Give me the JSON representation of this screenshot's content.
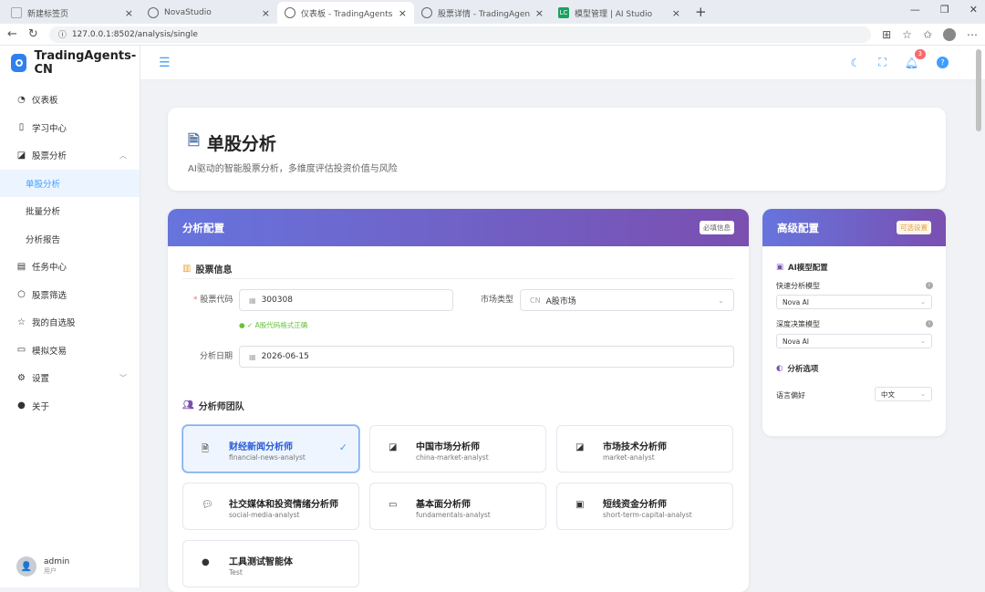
{
  "browser": {
    "tabs": [
      {
        "title": "新建标签页",
        "icon": "page-icon"
      },
      {
        "title": "NovaStudio",
        "icon": "globe-icon"
      },
      {
        "title": "仪表板 - TradingAgents-CN",
        "icon": "globe-icon",
        "active": true
      },
      {
        "title": "股票详情 - TradingAgents-CN",
        "icon": "globe-icon"
      },
      {
        "title": "模型管理 | AI Studio",
        "icon": "ai-studio-icon",
        "icon_text": "LC"
      }
    ],
    "new_tab": "+",
    "url": "127.0.0.1:8502/analysis/single"
  },
  "app": {
    "name": "TradingAgents-CN",
    "notification_count": "3"
  },
  "sidebar": {
    "items": [
      {
        "label": "仪表板",
        "icon": "dashboard-icon"
      },
      {
        "label": "学习中心",
        "icon": "book-icon"
      },
      {
        "label": "股票分析",
        "icon": "chart-icon",
        "expanded": true
      },
      {
        "label": "单股分析",
        "sub": true,
        "active": true
      },
      {
        "label": "批量分析",
        "sub": true
      },
      {
        "label": "分析报告",
        "sub": true
      },
      {
        "label": "任务中心",
        "icon": "clipboard-icon"
      },
      {
        "label": "股票筛选",
        "icon": "search-icon"
      },
      {
        "label": "我的自选股",
        "icon": "star-icon"
      },
      {
        "label": "模拟交易",
        "icon": "card-icon"
      },
      {
        "label": "设置",
        "icon": "gear-icon"
      },
      {
        "label": "关于",
        "icon": "info-icon"
      }
    ],
    "user": {
      "name": "admin",
      "role": "用户"
    }
  },
  "hero": {
    "title": "单股分析",
    "subtitle": "AI驱动的智能股票分析，多维度评估投资价值与风险"
  },
  "config": {
    "title": "分析配置",
    "tag": "必填信息",
    "stock_section": "股票信息",
    "code_label": "股票代码",
    "code_value": "300308",
    "code_hint": "✓ A股代码格式正确",
    "market_label": "市场类型",
    "market_prefix": "CN",
    "market_value": "A股市场",
    "date_label": "分析日期",
    "date_value": "2026-06-15",
    "team_section": "分析师团队",
    "analysts": [
      {
        "name": "财经新闻分析师",
        "id": "financial-news-analyst",
        "icon": "document-icon",
        "selected": true
      },
      {
        "name": "中国市场分析师",
        "id": "china-market-analyst",
        "icon": "trend-icon"
      },
      {
        "name": "市场技术分析师",
        "id": "market-analyst",
        "icon": "trend-icon"
      },
      {
        "name": "社交媒体和投资情绪分析师",
        "id": "social-media-analyst",
        "icon": "chat-icon"
      },
      {
        "name": "基本面分析师",
        "id": "fundamentals-analyst",
        "icon": "presentation-icon"
      },
      {
        "name": "短线资金分析师",
        "id": "short-term-capital-analyst",
        "icon": "wallet-icon"
      },
      {
        "name": "工具测试智能体",
        "id": "Test",
        "icon": "info-icon"
      }
    ]
  },
  "advanced": {
    "title": "高级配置",
    "tag": "可选设置",
    "model_section": "AI模型配置",
    "quick_label": "快速分析模型",
    "quick_value": "Nova AI",
    "deep_label": "深度决策模型",
    "deep_value": "Nova AI",
    "options_section": "分析选项",
    "lang_label": "语言偏好",
    "lang_value": "中文"
  }
}
